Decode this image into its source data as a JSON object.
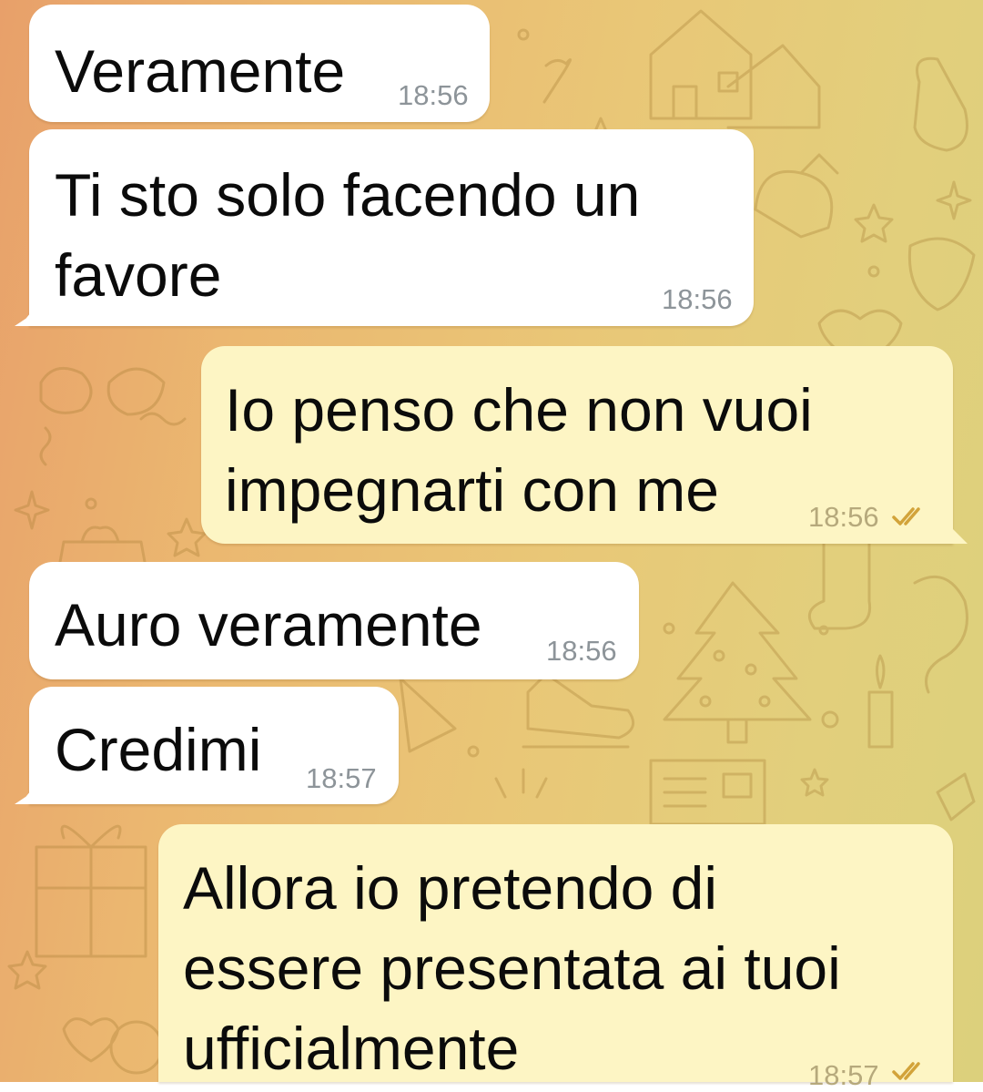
{
  "colors": {
    "incoming_bubble": "#ffffff",
    "outgoing_bubble": "#fdf5c4",
    "timestamp": "#8d9499",
    "read_ticks": "#d2a33a",
    "wallpaper_gradient_start": "#e8a06a",
    "wallpaper_gradient_end": "#dcd07c"
  },
  "icons": {
    "read_status": "double-check-icon",
    "wallpaper": "christmas-doodle-pattern"
  },
  "messages": [
    {
      "direction": "incoming",
      "text": "Veramente",
      "time": "18:56"
    },
    {
      "direction": "incoming",
      "text": "Ti sto solo facendo un\nfavore",
      "time": "18:56"
    },
    {
      "direction": "outgoing",
      "text": "Io penso che non vuoi\nimpegnarti con me",
      "time": "18:56",
      "status": "read"
    },
    {
      "direction": "incoming",
      "text": "Auro veramente",
      "time": "18:56"
    },
    {
      "direction": "incoming",
      "text": "Credimi",
      "time": "18:57"
    },
    {
      "direction": "outgoing",
      "text": "Allora io pretendo di\nessere presentata ai tuoi\nufficialmente",
      "time": "18:57",
      "status": "read"
    }
  ]
}
